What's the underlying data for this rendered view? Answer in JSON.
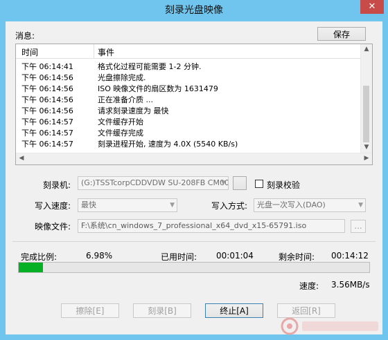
{
  "window": {
    "title": "刻录光盘映像",
    "close_glyph": "✕"
  },
  "messages": {
    "label": "消息:",
    "save_button": "保存",
    "columns": [
      "时间",
      "事件"
    ],
    "rows": [
      {
        "time": "下午 06:14:41",
        "event": "格式化过程可能需要 1-2 分钟."
      },
      {
        "time": "下午 06:14:56",
        "event": "光盘擦除完成."
      },
      {
        "time": "下午 06:14:56",
        "event": "ISO 映像文件的扇区数为 1631479"
      },
      {
        "time": "下午 06:14:56",
        "event": "正在准备介质 ..."
      },
      {
        "time": "下午 06:14:56",
        "event": "请求刻录速度为 最快"
      },
      {
        "time": "下午 06:14:57",
        "event": "文件缓存开始"
      },
      {
        "time": "下午 06:14:57",
        "event": "文件缓存完成"
      },
      {
        "time": "下午 06:14:57",
        "event": "刻录进程开始, 速度为 4.0X (5540 KB/s)"
      }
    ]
  },
  "burner": {
    "label": "刻录机:",
    "value": "(G:)TSSTcorpCDDVDW SU-208FB CM00",
    "verify_label": "刻录校验",
    "verify_checked": false
  },
  "write_speed": {
    "label": "写入速度:",
    "value": "最快"
  },
  "write_mode": {
    "label": "写入方式:",
    "value": "光盘一次写入(DAO)"
  },
  "image_file": {
    "label": "映像文件:",
    "value": "F:\\系统\\cn_windows_7_professional_x64_dvd_x15-65791.iso",
    "browse": "..."
  },
  "status": {
    "percent_label": "完成比例:",
    "percent_value": "6.98%",
    "progress_fraction": 0.0698,
    "elapsed_label": "已用时间:",
    "elapsed_value": "00:01:04",
    "remaining_label": "剩余时间:",
    "remaining_value": "00:14:12",
    "speed_label": "速度:",
    "speed_value": "3.56MB/s"
  },
  "buttons": {
    "erase": "擦除[E]",
    "burn": "刻录[B]",
    "stop": "终止[A]",
    "back": "返回[R]"
  },
  "colors": {
    "progress": "#06b025",
    "titlebar": "#6fc5ee",
    "close": "#c74b48"
  }
}
